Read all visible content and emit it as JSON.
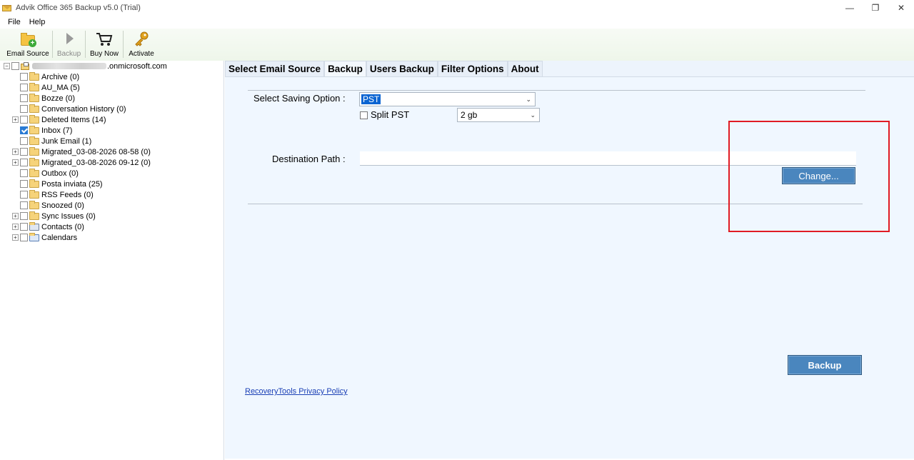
{
  "window": {
    "title": "Advik Office 365 Backup v5.0 (Trial)",
    "controls": [
      "—",
      "❐",
      "✕"
    ]
  },
  "menu": [
    "File",
    "Help"
  ],
  "toolbar": {
    "email_source": "Email Source",
    "backup": "Backup",
    "buy_now": "Buy Now",
    "activate": "Activate"
  },
  "tree": {
    "account_suffix": ".onmicrosoft.com",
    "items": [
      {
        "label": "Archive (0)",
        "checked": false,
        "expandable": false
      },
      {
        "label": "AU_MA (5)",
        "checked": false,
        "expandable": false
      },
      {
        "label": "Bozze (0)",
        "checked": false,
        "expandable": false
      },
      {
        "label": "Conversation History (0)",
        "checked": false,
        "expandable": false
      },
      {
        "label": "Deleted Items (14)",
        "checked": false,
        "expandable": true
      },
      {
        "label": "Inbox (7)",
        "checked": true,
        "expandable": false
      },
      {
        "label": "Junk Email (1)",
        "checked": false,
        "expandable": false
      },
      {
        "label": "Migrated_03-08-2026 08-58 (0)",
        "checked": false,
        "expandable": true
      },
      {
        "label": "Migrated_03-08-2026 09-12 (0)",
        "checked": false,
        "expandable": true
      },
      {
        "label": "Outbox (0)",
        "checked": false,
        "expandable": false
      },
      {
        "label": "Posta inviata (25)",
        "checked": false,
        "expandable": false
      },
      {
        "label": "RSS Feeds (0)",
        "checked": false,
        "expandable": false
      },
      {
        "label": "Snoozed (0)",
        "checked": false,
        "expandable": false
      },
      {
        "label": "Sync Issues (0)",
        "checked": false,
        "expandable": true
      },
      {
        "label": "Contacts (0)",
        "checked": false,
        "expandable": true
      },
      {
        "label": "Calendars",
        "checked": false,
        "expandable": true
      }
    ]
  },
  "tabs": [
    "Select Email Source",
    "Backup",
    "Users Backup",
    "Filter Options",
    "About"
  ],
  "active_tab": "Backup",
  "backup": {
    "saving_option_label": "Select Saving Option :",
    "saving_option_value": "PST",
    "split_label": "Split PST",
    "split_checked": false,
    "split_size_value": "2 gb",
    "destination_label": "Destination Path :",
    "destination_value": "",
    "change_button": "Change...",
    "backup_button": "Backup",
    "privacy_link": "RecoveryTools Privacy Policy"
  },
  "colors": {
    "highlight_box": "#e01b24",
    "button_blue": "#4a86be",
    "pane_bg": "#f0f7ff"
  }
}
